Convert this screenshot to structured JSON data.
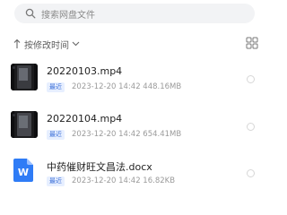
{
  "search": {
    "placeholder": "搜索网盘文件"
  },
  "sort": {
    "label": "按修改时间"
  },
  "files": [
    {
      "name": "20220103.mp4",
      "badge": "最近",
      "meta": "2023-12-20  14:42  448.16MB",
      "icon": "video-thumbnail"
    },
    {
      "name": "20220104.mp4",
      "badge": "最近",
      "meta": "2023-12-20  14:42  654.41MB",
      "icon": "video-thumbnail"
    },
    {
      "name": "中药催财旺文昌法.docx",
      "badge": "最近",
      "meta": "2023-12-20  14:42  16.82KB",
      "icon": "word-doc-icon"
    }
  ],
  "colors": {
    "accent": "#3b6fd8",
    "badge_bg": "#e7efff",
    "word_blue": "#2f7cf6",
    "search_bg": "#f2f3f5"
  }
}
